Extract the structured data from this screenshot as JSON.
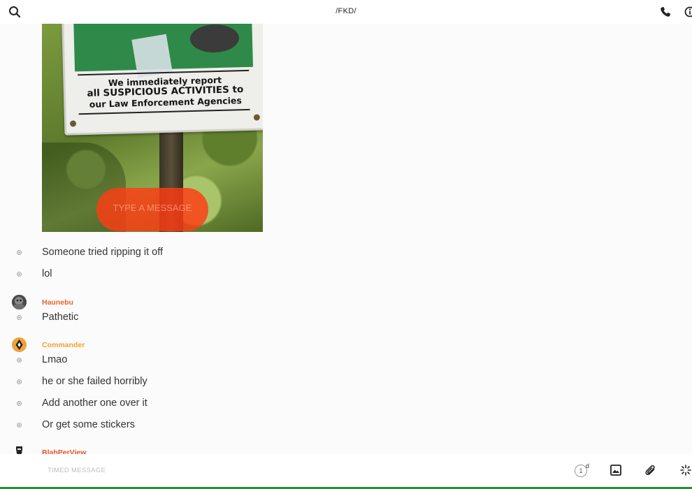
{
  "header": {
    "title": "/FKD/",
    "search_icon": "search-icon",
    "call_icon": "phone-icon",
    "info_icon": "info-icon"
  },
  "photo": {
    "sign_text_lines": [
      "We immediately report",
      "all SUSPICIOUS ACTIVITIES to",
      "our Law Enforcement Agencies"
    ],
    "overlay_placeholder": "TYPE A MESSAGE"
  },
  "messages": [
    {
      "text": "Someone tried ripping it off"
    },
    {
      "text": "lol"
    },
    {
      "sender": "Haunebu",
      "text": "Pathetic"
    },
    {
      "sender": "Commander",
      "text": "Lmao"
    },
    {
      "text": "he or she failed horribly"
    },
    {
      "text": "Add another one over it"
    },
    {
      "text": "Or get some stickers"
    },
    {
      "sender": "BlahPerView"
    }
  ],
  "colors": {
    "sender_haunebu": "#e8642a",
    "sender_commander": "#f0a23a",
    "sender_blahperview": "#e2552a",
    "accent_line": "#2f8a3a"
  },
  "composer": {
    "timed_message_label": "TIMED MESSAGE",
    "timer_value": "1",
    "timer_unit": "d",
    "icons": [
      "timer-icon",
      "image-icon",
      "paperclip-icon",
      "sparkle-icon"
    ]
  }
}
